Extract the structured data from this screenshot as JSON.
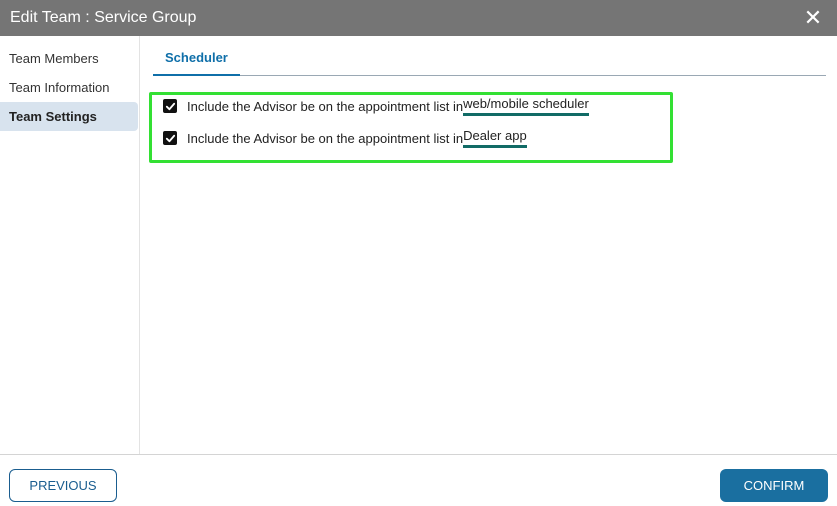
{
  "dialog": {
    "title": "Edit Team : Service Group",
    "close_icon": "close-icon"
  },
  "sidebar": {
    "items": [
      {
        "label": "Team Members",
        "active": false
      },
      {
        "label": "Team Information",
        "active": false
      },
      {
        "label": "Team Settings",
        "active": true
      }
    ]
  },
  "tabs": [
    {
      "label": "Scheduler",
      "active": true
    }
  ],
  "settings": {
    "options": [
      {
        "prefix": "Include the Advisor be on the appointment list in ",
        "highlight": "web/mobile scheduler",
        "checked": true
      },
      {
        "prefix": "Include the Advisor be on the appointment list in ",
        "highlight": "Dealer app",
        "checked": true
      }
    ]
  },
  "footer": {
    "previous_label": "PREVIOUS",
    "confirm_label": "CONFIRM"
  },
  "colors": {
    "titlebar": "#757575",
    "accent": "#1a6fa0",
    "highlight_border": "#33e033",
    "underline": "#116b66"
  }
}
